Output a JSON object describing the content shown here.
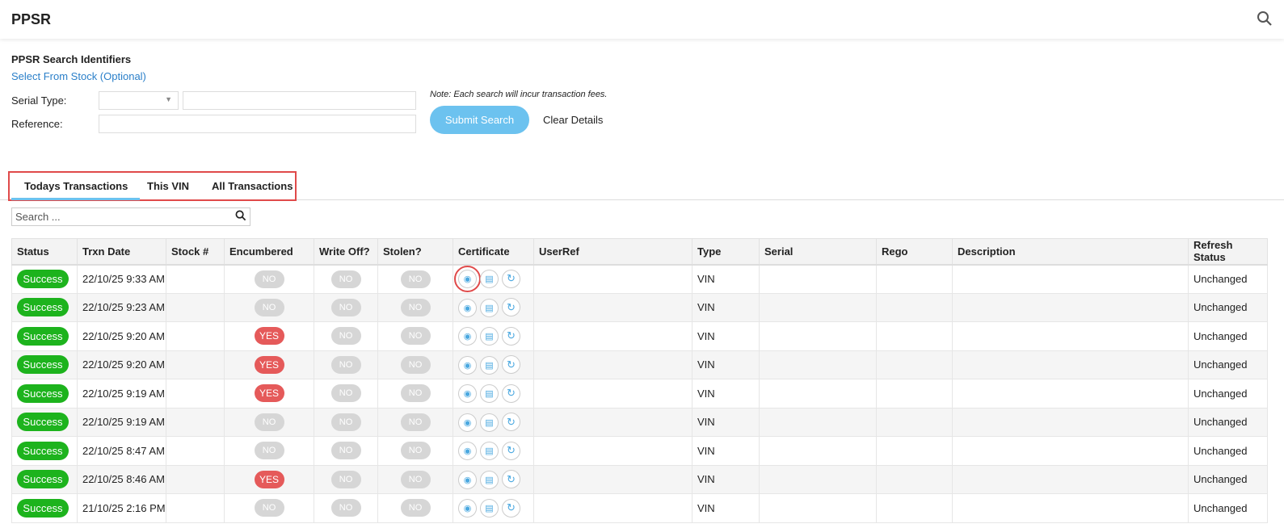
{
  "header": {
    "title": "PPSR"
  },
  "form": {
    "section_title": "PPSR Search Identifiers",
    "select_stock_link": "Select From Stock (Optional)",
    "serial_type_label": "Serial Type:",
    "reference_label": "Reference:",
    "note": "Note: Each search will incur transaction fees.",
    "submit_label": "Submit Search",
    "clear_label": "Clear Details"
  },
  "tabs": [
    {
      "label": "Todays Transactions",
      "active": true
    },
    {
      "label": "This VIN"
    },
    {
      "label": "All Transactions"
    }
  ],
  "search": {
    "placeholder": "Search ..."
  },
  "table": {
    "columns": [
      "Status",
      "Trxn Date",
      "Stock #",
      "Encumbered",
      "Write Off?",
      "Stolen?",
      "Certificate",
      "UserRef",
      "Type",
      "Serial",
      "Rego",
      "Description",
      "Refresh Status"
    ],
    "rows": [
      {
        "status": "Success",
        "date": "22/10/25 9:33 AM",
        "encumbered": "NO",
        "writeoff": "NO",
        "stolen": "NO",
        "type": "VIN",
        "refresh": "Unchanged"
      },
      {
        "status": "Success",
        "date": "22/10/25 9:23 AM",
        "encumbered": "NO",
        "writeoff": "NO",
        "stolen": "NO",
        "type": "VIN",
        "refresh": "Unchanged"
      },
      {
        "status": "Success",
        "date": "22/10/25 9:20 AM",
        "encumbered": "YES",
        "writeoff": "NO",
        "stolen": "NO",
        "type": "VIN",
        "refresh": "Unchanged"
      },
      {
        "status": "Success",
        "date": "22/10/25 9:20 AM",
        "encumbered": "YES",
        "writeoff": "NO",
        "stolen": "NO",
        "type": "VIN",
        "refresh": "Unchanged"
      },
      {
        "status": "Success",
        "date": "22/10/25 9:19 AM",
        "encumbered": "YES",
        "writeoff": "NO",
        "stolen": "NO",
        "type": "VIN",
        "refresh": "Unchanged"
      },
      {
        "status": "Success",
        "date": "22/10/25 9:19 AM",
        "encumbered": "NO",
        "writeoff": "NO",
        "stolen": "NO",
        "type": "VIN",
        "refresh": "Unchanged"
      },
      {
        "status": "Success",
        "date": "22/10/25 8:47 AM",
        "encumbered": "NO",
        "writeoff": "NO",
        "stolen": "NO",
        "type": "VIN",
        "refresh": "Unchanged"
      },
      {
        "status": "Success",
        "date": "22/10/25 8:46 AM",
        "encumbered": "YES",
        "writeoff": "NO",
        "stolen": "NO",
        "type": "VIN",
        "refresh": "Unchanged"
      },
      {
        "status": "Success",
        "date": "21/10/25 2:16 PM",
        "encumbered": "NO",
        "writeoff": "NO",
        "stolen": "NO",
        "type": "VIN",
        "refresh": "Unchanged"
      }
    ]
  },
  "colors": {
    "success": "#1db31d",
    "yes": "#e55a5a",
    "no": "#d6d6d6",
    "accent": "#6cc2ef",
    "highlight": "#e04a4a"
  }
}
